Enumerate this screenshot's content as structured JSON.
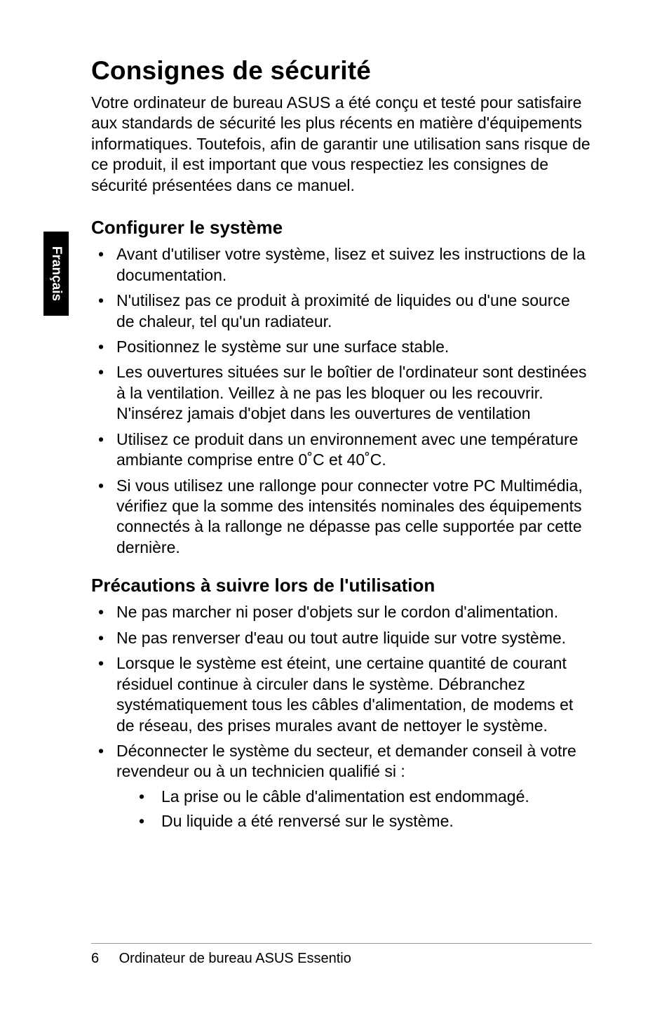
{
  "side_tab": "Français",
  "title": "Consignes de sécurité",
  "intro": "Votre ordinateur de bureau ASUS a été conçu et testé pour satisfaire aux standards de sécurité les plus récents en matière d'équipements informatiques. Toutefois,  afin de garantir une utilisation sans risque de ce produit, il est important que vous respectiez les consignes de sécurité présentées dans ce manuel.",
  "section1": {
    "heading": "Configurer le système",
    "items": [
      "Avant d'utiliser votre système, lisez et suivez les instructions de la documentation.",
      "N'utilisez pas ce produit à proximité de liquides ou d'une source de chaleur, tel qu'un radiateur.",
      "Positionnez le système sur une surface stable.",
      "Les ouvertures situées sur le boîtier de l'ordinateur sont destinées à la ventilation. Veillez à ne pas les bloquer ou les recouvrir. N'insérez jamais d'objet dans les ouvertures de ventilation",
      "Utilisez ce produit dans un environnement avec une température ambiante comprise entre 0˚C et 40˚C.",
      "Si vous utilisez une rallonge pour connecter votre PC Multimédia, vérifiez que la somme des intensités nominales des équipements connectés à la rallonge ne dépasse pas celle supportée par cette dernière."
    ]
  },
  "section2": {
    "heading": "Précautions à suivre lors de l'utilisation",
    "items": [
      "Ne pas marcher ni poser d'objets sur le cordon d'alimentation.",
      "Ne pas renverser d'eau ou tout autre liquide sur votre système.",
      "Lorsque le système est éteint, une certaine quantité de courant résiduel continue à circuler dans le système. Débranchez systématiquement tous les câbles d'alimentation, de modems et de réseau, des prises murales avant de nettoyer le système.",
      "Déconnecter le système du secteur, et demander conseil à votre revendeur ou à un technicien qualifié si :"
    ],
    "subitems": [
      "La prise ou le câble d'alimentation est endommagé.",
      "Du liquide a été renversé sur le système."
    ]
  },
  "footer": {
    "page_number": "6",
    "text": "Ordinateur de bureau ASUS Essentio"
  }
}
